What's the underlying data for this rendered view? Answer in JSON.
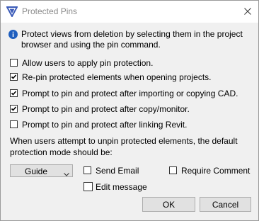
{
  "window": {
    "title": "Protected Pins",
    "icon": "app-logo-icon",
    "close_icon": "close-icon"
  },
  "info": {
    "icon": "info-icon",
    "text": "Protect views from deletion by selecting them in the project browser and using the pin command."
  },
  "options": [
    {
      "label": "Allow users to apply pin protection.",
      "checked": false
    },
    {
      "label": "Re-pin protected elements when opening projects.",
      "checked": true
    },
    {
      "label": "Prompt to pin and protect after importing or copying CAD.",
      "checked": true
    },
    {
      "label": "Prompt to pin and protect after copy/monitor.",
      "checked": true
    },
    {
      "label": "Prompt to pin and protect after linking Revit.",
      "checked": false
    }
  ],
  "protection": {
    "description": "When users attempt to unpin protected elements, the default protection mode should be:",
    "mode_value": "Guide",
    "send_email_label": "Send Email",
    "send_email_checked": false,
    "require_comment_label": "Require Comment",
    "require_comment_checked": false,
    "edit_message_label": "Edit message",
    "edit_message_checked": false
  },
  "buttons": {
    "ok_label": "OK",
    "cancel_label": "Cancel"
  },
  "colors": {
    "accent": "#3b5bb8",
    "titlebar_bg": "#ffffff",
    "dialog_bg": "#f0f0f0",
    "button_bg": "#e1e1e1"
  }
}
